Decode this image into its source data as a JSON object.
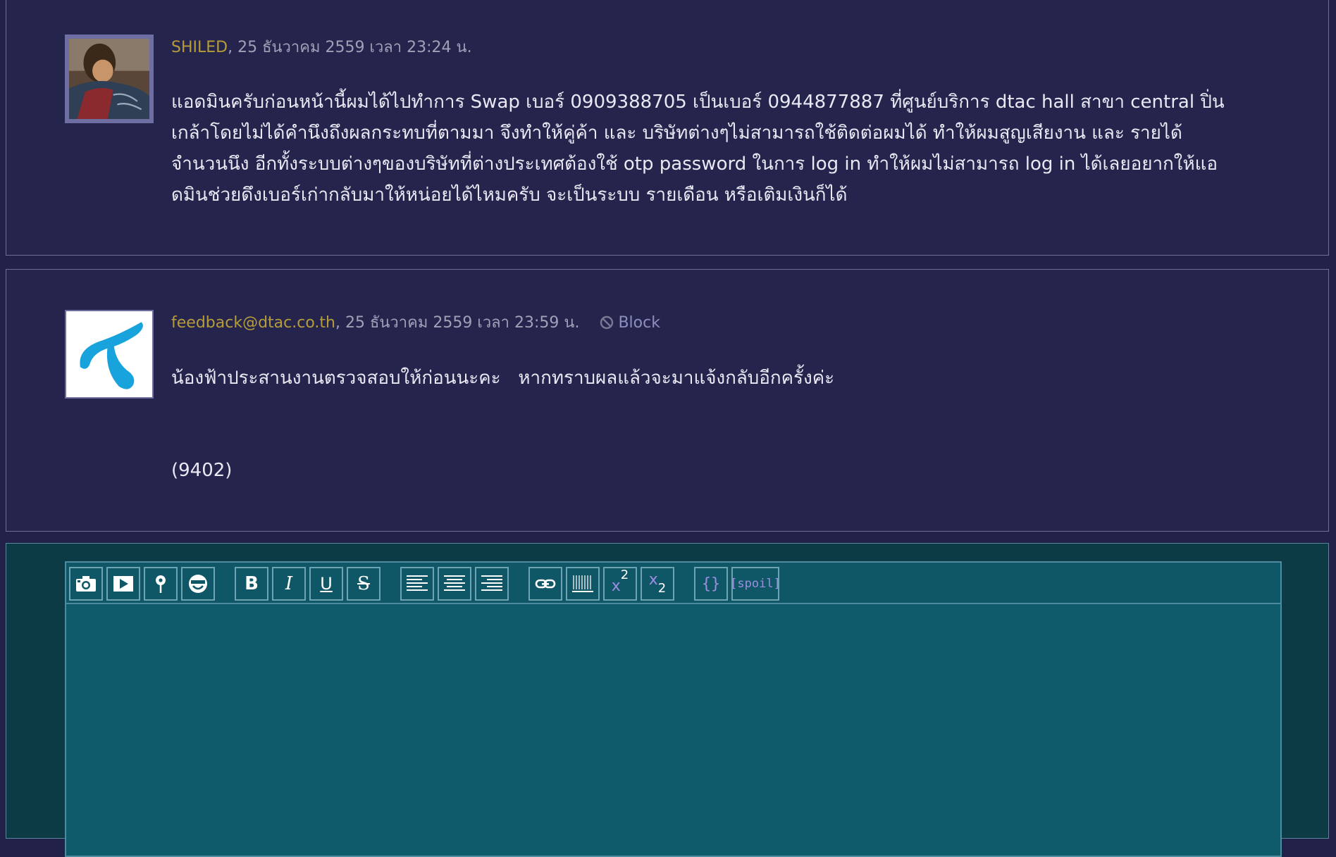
{
  "comments": [
    {
      "username": "SHILED",
      "datetime": ", 25 ธันวาคม 2559 เวลา 23:24 น.",
      "lines": [
        "แอดมินครับก่อนหน้านี้ผมได้ไปทำการ Swap เบอร์ 0909388705 เป็นเบอร์ 0944877887 ที่ศูนย์บริการ dtac hall สาขา central ปิ่น",
        "เกล้าโดยไม่ได้คำนึงถึงผลกระทบที่ตามมา จึงทำให้คู่ค้า และ บริษัทต่างๆไม่สามารถใช้ติดต่อผมได้ ทำให้ผมสูญเสียงาน และ รายได้",
        "จำนวนนึง อีกทั้งระบบต่างๆของบริษัทที่ต่างประเทศต้องใช้ otp password ในการ log in ทำให้ผมไม่สามารถ log in ได้เลยอยากให้แอ",
        "ดมินช่วยดึงเบอร์เก่ากลับมาให้หน่อยได้ไหมครับ จะเป็นระบบ รายเดือน หรือเติมเงินก็ได้"
      ]
    },
    {
      "username": "feedback@dtac.co.th",
      "datetime": ", 25 ธันวาคม 2559 เวลา 23:59 น.",
      "block_label": "Block",
      "text": "น้องฟ้าประสานงานตรวจสอบให้ก่อนนะคะ   หากทราบผลแล้วจะมาแจ้งกลับอีกครั้งค่ะ",
      "signature": "(9402)"
    }
  ],
  "toolbar": {
    "bold": "B",
    "italic": "I",
    "underline": "U",
    "strike": "S",
    "superscript_base": "x",
    "superscript_exp": "2",
    "subscript_base": "x",
    "subscript_exp": "2",
    "code": "{}",
    "spoil": "[spoil]"
  },
  "colors": {
    "background": "#22214a",
    "username": "#b79c3a",
    "meta": "#a2a0b6",
    "body_text": "#e9e8f3",
    "editor_bg": "#0f5b6b",
    "accent_purple": "#9c8ee0"
  }
}
